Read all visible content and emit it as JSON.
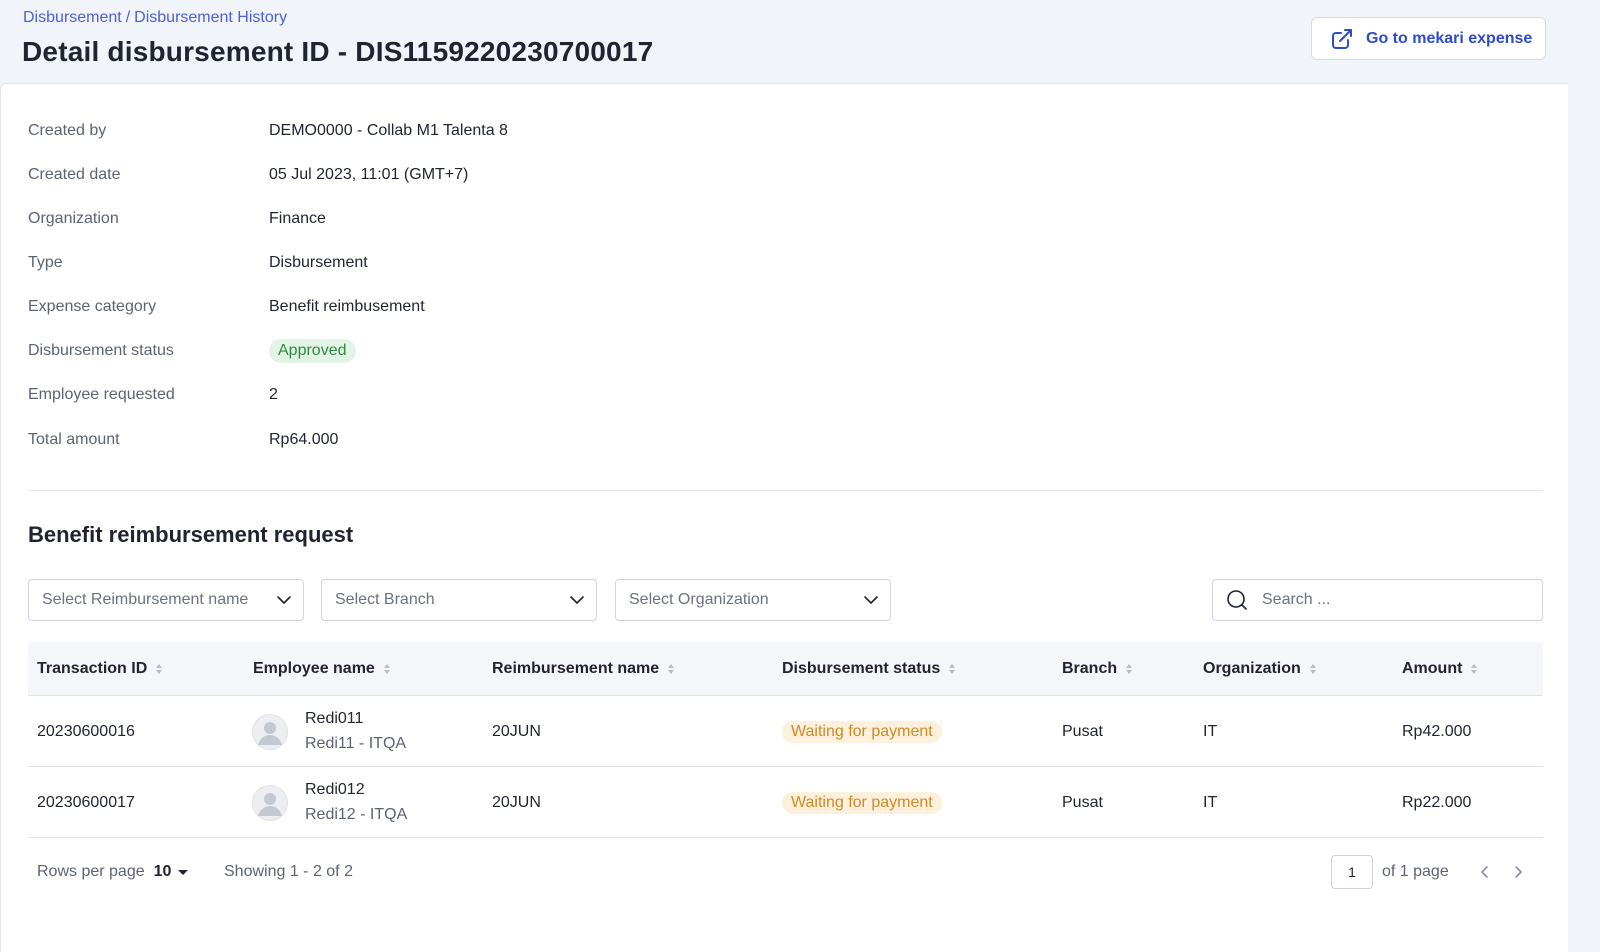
{
  "breadcrumb": {
    "items": [
      "Disbursement",
      "Disbursement History"
    ],
    "separator": "/"
  },
  "page_title": "Detail disbursement ID - DIS1159220230700017",
  "external_button": {
    "label": "Go to mekari expense",
    "icon": "external-link-icon"
  },
  "details": [
    {
      "label": "Created by",
      "value": "DEMO0000 - Collab M1 Talenta 8"
    },
    {
      "label": "Created date",
      "value": "05 Jul 2023, 11:01 (GMT+7)"
    },
    {
      "label": "Organization",
      "value": "Finance"
    },
    {
      "label": "Type",
      "value": "Disbursement"
    },
    {
      "label": "Expense category",
      "value": "Benefit reimbusement"
    },
    {
      "label": "Disbursement status",
      "value": "Approved"
    },
    {
      "label": "Employee requested",
      "value": "2"
    },
    {
      "label": "Total amount",
      "value": "Rp64.000"
    }
  ],
  "section_title": "Benefit reimbursement request",
  "filters": {
    "reimbursement": "Select Reimbursement name",
    "branch": "Select Branch",
    "organization": "Select Organization",
    "search_placeholder": "Search ..."
  },
  "table": {
    "columns": [
      "Transaction ID",
      "Employee name",
      "Reimbursement name",
      "Disbursement status",
      "Branch",
      "Organization",
      "Amount"
    ],
    "rows": [
      {
        "transaction_id": "20230600016",
        "employee_name": "Redi011",
        "employee_sub": "Redi11 - ITQA",
        "reimbursement": "20JUN",
        "status": "Waiting for payment",
        "branch": "Pusat",
        "organization": "IT",
        "amount": "Rp42.000"
      },
      {
        "transaction_id": "20230600017",
        "employee_name": "Redi012",
        "employee_sub": "Redi12 - ITQA",
        "reimbursement": "20JUN",
        "status": "Waiting for payment",
        "branch": "Pusat",
        "organization": "IT",
        "amount": "Rp22.000"
      }
    ]
  },
  "pagination": {
    "rows_per_page_label": "Rows per page",
    "rows_per_page": "10",
    "showing": "Showing 1 - 2 of 2",
    "current_page": "1",
    "of_pages": "of 1 page"
  },
  "colors": {
    "accent": "#4b61dd",
    "approved_bg": "#e3f4e6",
    "approved_text": "#2e8a43",
    "waiting_bg": "#fdf0dc",
    "waiting_text": "#d08a26"
  }
}
